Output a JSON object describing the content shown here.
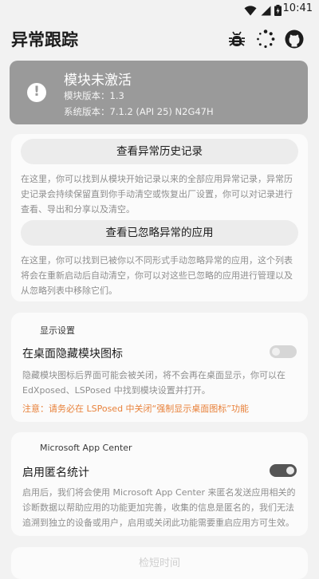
{
  "status_bar": {
    "time": "10:41",
    "icons": [
      "wifi-icon",
      "cell-signal-icon",
      "battery-icon"
    ]
  },
  "app_bar": {
    "title": "异常跟踪",
    "actions": [
      "bug-icon",
      "loading-spinner-icon",
      "github-icon"
    ]
  },
  "module_status": {
    "icon": "exclamation-icon",
    "headline": "模块未激活",
    "module_version": "模块版本：1.3",
    "system_version": "系统版本：7.1.2 (API 25) N2G47H",
    "color": "#9a9a9a"
  },
  "records_card": {
    "history_button": "查看异常历史记录",
    "history_desc": "在这里，你可以找到从模块开始记录以来的全部应用异常记录，异常历史记录会持续保留直到你手动清空或恢复出厂设置，你可以对记录进行查看、导出和分享以及清空。",
    "ignored_button": "查看已忽略异常的应用",
    "ignored_desc": "在这里，你可以找到已被你以不同形式手动忽略异常的应用，这个列表将会在重新启动后自动清空，你可以对这些已忽略的应用进行管理以及从忽略列表中移除它们。"
  },
  "display_settings": {
    "section_title": "显示设置",
    "hide_icon_label": "在桌面隐藏模块图标",
    "hide_icon_enabled": false,
    "hide_icon_desc": "隐藏模块图标后界面可能会被关闭，将不会再在桌面显示，你可以在 EdXposed、LSPosed 中找到模块设置并打开。",
    "hide_icon_note": "注意：请务必在 LSPosed 中关闭“强制显示桌面图标”功能",
    "note_color": "#e8813a"
  },
  "app_center": {
    "section_title": "Microsoft App Center",
    "anon_label": "启用匿名统计",
    "anon_enabled": true,
    "anon_desc": "启用后，我们将会使用 Microsoft App Center 来匿名发送应用相关的诊断数据以帮助应用的功能更加完善，收集的信息是匿名的，我们无法追溯到独立的设备或用户，启用或关闭此功能需要重启应用方可生效。"
  },
  "next_card": {
    "title": "检短时间"
  }
}
